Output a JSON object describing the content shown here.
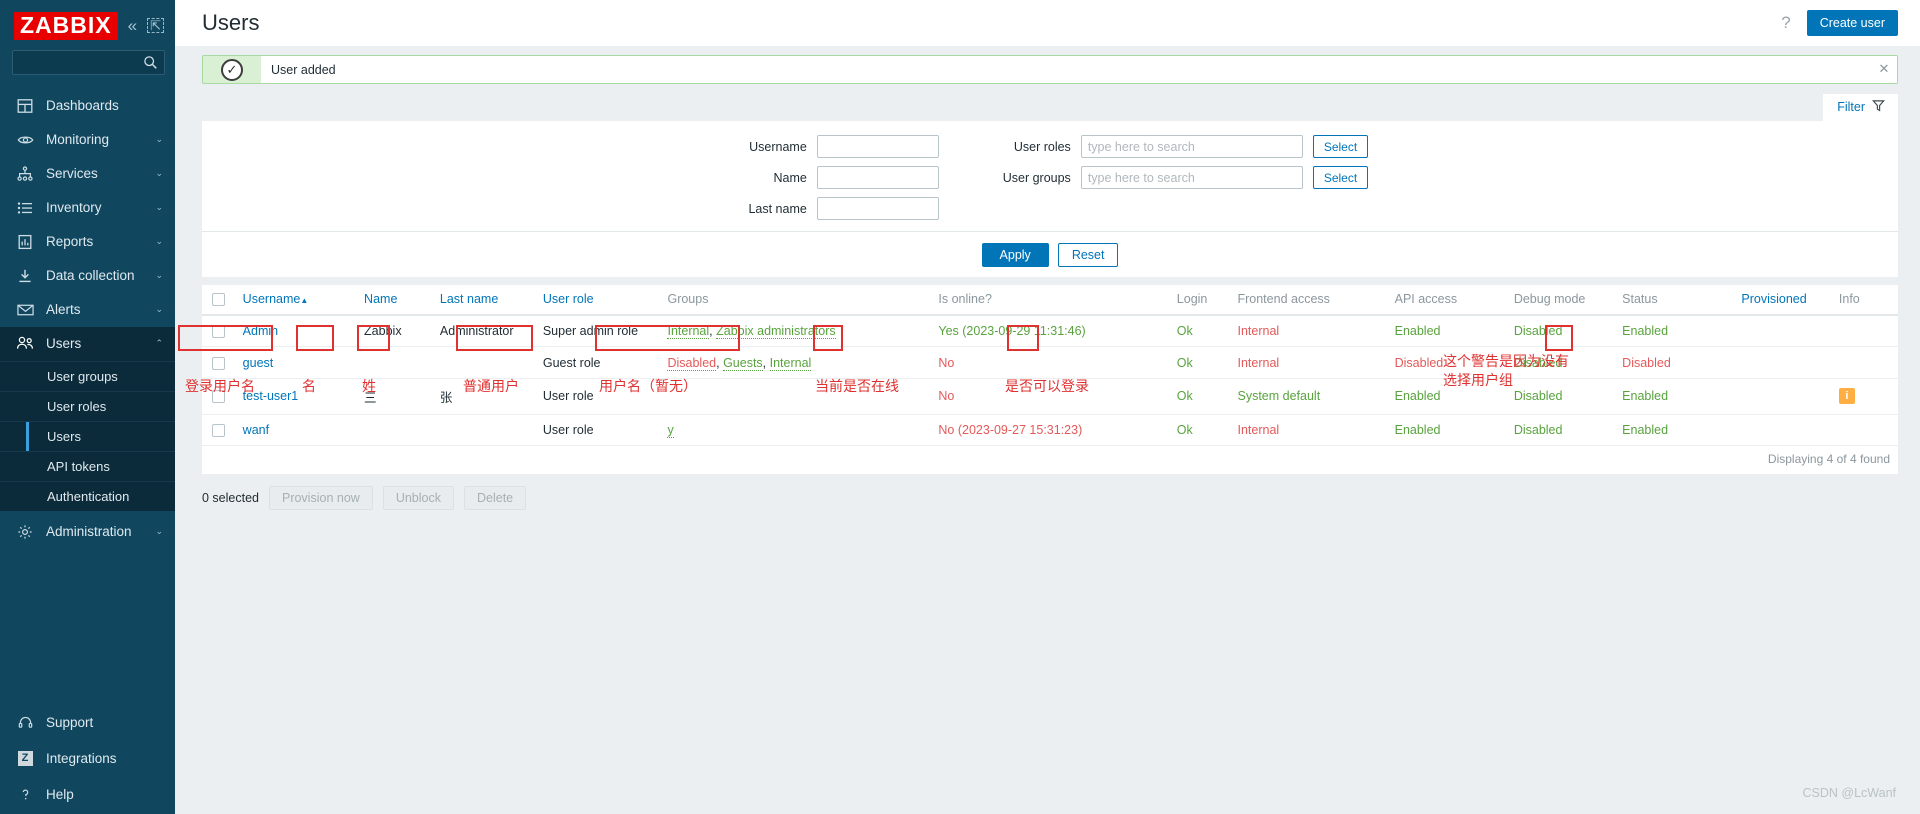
{
  "sidebar": {
    "logo": "ZABBIX",
    "collapse_icon": "chevron-double-left-icon",
    "expand_icon": "expand-icon",
    "search_placeholder": "",
    "items": [
      {
        "label": "Dashboards",
        "icon": "dashboard-icon",
        "chevron": ""
      },
      {
        "label": "Monitoring",
        "icon": "eye-icon",
        "chevron": "⌄"
      },
      {
        "label": "Services",
        "icon": "services-icon",
        "chevron": "⌄"
      },
      {
        "label": "Inventory",
        "icon": "list-icon",
        "chevron": "⌄"
      },
      {
        "label": "Reports",
        "icon": "report-icon",
        "chevron": "⌄"
      },
      {
        "label": "Data collection",
        "icon": "download-icon",
        "chevron": "⌄"
      },
      {
        "label": "Alerts",
        "icon": "envelope-icon",
        "chevron": "⌄"
      },
      {
        "label": "Users",
        "icon": "users-icon",
        "chevron": "⌃"
      }
    ],
    "submenu": [
      {
        "label": "User groups",
        "selected": false
      },
      {
        "label": "User roles",
        "selected": false
      },
      {
        "label": "Users",
        "selected": true
      },
      {
        "label": "API tokens",
        "selected": false
      },
      {
        "label": "Authentication",
        "selected": false
      }
    ],
    "after_submenu": [
      {
        "label": "Administration",
        "icon": "gear-icon",
        "chevron": "⌄"
      }
    ],
    "bottom": [
      {
        "label": "Support",
        "icon": "headset-icon"
      },
      {
        "label": "Integrations",
        "icon": "z-badge-icon"
      },
      {
        "label": "Help",
        "icon": "question-icon"
      }
    ]
  },
  "header": {
    "title": "Users",
    "help_icon": "question-mark-icon",
    "create_button": "Create user"
  },
  "message": {
    "icon": "check-circle-icon",
    "text": "User added",
    "close_icon": "close-icon"
  },
  "filter": {
    "tab_label": "Filter",
    "tab_icon": "funnel-icon",
    "fields": {
      "username_label": "Username",
      "username_value": "",
      "name_label": "Name",
      "name_value": "",
      "lastname_label": "Last name",
      "lastname_value": "",
      "user_roles_label": "User roles",
      "user_roles_placeholder": "type here to search",
      "user_roles_value": "",
      "user_groups_label": "User groups",
      "user_groups_placeholder": "type here to search",
      "user_groups_value": "",
      "select_label": "Select"
    },
    "apply_label": "Apply",
    "reset_label": "Reset"
  },
  "table": {
    "columns": [
      {
        "label": "Username",
        "link": true,
        "sort": "▲"
      },
      {
        "label": "Name",
        "link": true,
        "sort": ""
      },
      {
        "label": "Last name",
        "link": true,
        "sort": ""
      },
      {
        "label": "User role",
        "link": true,
        "sort": ""
      },
      {
        "label": "Groups",
        "link": false,
        "sort": ""
      },
      {
        "label": "Is online?",
        "link": false,
        "sort": ""
      },
      {
        "label": "Login",
        "link": false,
        "sort": ""
      },
      {
        "label": "Frontend access",
        "link": false,
        "sort": ""
      },
      {
        "label": "API access",
        "link": false,
        "sort": ""
      },
      {
        "label": "Debug mode",
        "link": false,
        "sort": ""
      },
      {
        "label": "Status",
        "link": false,
        "sort": ""
      },
      {
        "label": "Provisioned",
        "link": true,
        "sort": ""
      },
      {
        "label": "Info",
        "link": false,
        "sort": ""
      }
    ],
    "rows": [
      {
        "username": "Admin",
        "name": "Zabbix",
        "lastname": "Administrator",
        "role": "Super admin role",
        "groups": [
          {
            "text": "Internal",
            "color": "green"
          },
          {
            "text": "Zabbix administrators",
            "color": "green"
          }
        ],
        "online": "Yes (2023-09-29 11:31:46)",
        "online_color": "green",
        "login": "Ok",
        "login_color": "green",
        "frontend": "Internal",
        "frontend_color": "red",
        "api": "Enabled",
        "api_color": "green",
        "debug": "Disabled",
        "debug_color": "green",
        "status": "Enabled",
        "status_color": "green",
        "provisioned": "",
        "info": ""
      },
      {
        "username": "guest",
        "name": "",
        "lastname": "",
        "role": "Guest role",
        "groups": [
          {
            "text": "Disabled",
            "color": "red"
          },
          {
            "text": "Guests",
            "color": "green"
          },
          {
            "text": "Internal",
            "color": "green"
          }
        ],
        "online": "No",
        "online_color": "red",
        "login": "Ok",
        "login_color": "green",
        "frontend": "Internal",
        "frontend_color": "red",
        "api": "Disabled",
        "api_color": "red",
        "debug": "Disabled",
        "debug_color": "green",
        "status": "Disabled",
        "status_color": "red",
        "provisioned": "",
        "info": ""
      },
      {
        "username": "test-user1",
        "name": "三",
        "lastname": "张",
        "role": "User role",
        "groups": [],
        "online": "No",
        "online_color": "red",
        "login": "Ok",
        "login_color": "green",
        "frontend": "System default",
        "frontend_color": "green",
        "api": "Enabled",
        "api_color": "green",
        "debug": "Disabled",
        "debug_color": "green",
        "status": "Enabled",
        "status_color": "green",
        "provisioned": "",
        "info": "i"
      },
      {
        "username": "wanf",
        "name": "",
        "lastname": "",
        "role": "User role",
        "groups": [
          {
            "text": "y",
            "color": "green"
          }
        ],
        "online": "No (2023-09-27 15:31:23)",
        "online_color": "red",
        "login": "Ok",
        "login_color": "green",
        "frontend": "Internal",
        "frontend_color": "red",
        "api": "Enabled",
        "api_color": "green",
        "debug": "Disabled",
        "debug_color": "green",
        "status": "Enabled",
        "status_color": "green",
        "provisioned": "",
        "info": ""
      }
    ],
    "displaying": "Displaying 4 of 4 found"
  },
  "footer": {
    "selected_count": "0 selected",
    "provision_label": "Provision now",
    "unblock_label": "Unblock",
    "delete_label": "Delete"
  },
  "annotations": {
    "username_note": "登录用户名",
    "name_note": "名",
    "lastname_note": "姓",
    "role_note": "普通用户",
    "groups_note": "用户名（暂无）",
    "online_note": "当前是否在线",
    "login_note": "是否可以登录",
    "info_note": "这个警告是因为没有\n选择用户组"
  },
  "watermark": "CSDN @LcWanf",
  "colors": {
    "accent": "#0275b8",
    "sidebar": "#10475f",
    "logo_red": "#e80000",
    "green": "#59a33e",
    "red": "#e45959",
    "annotation_red": "#e03131",
    "info_orange": "#ffae42"
  }
}
